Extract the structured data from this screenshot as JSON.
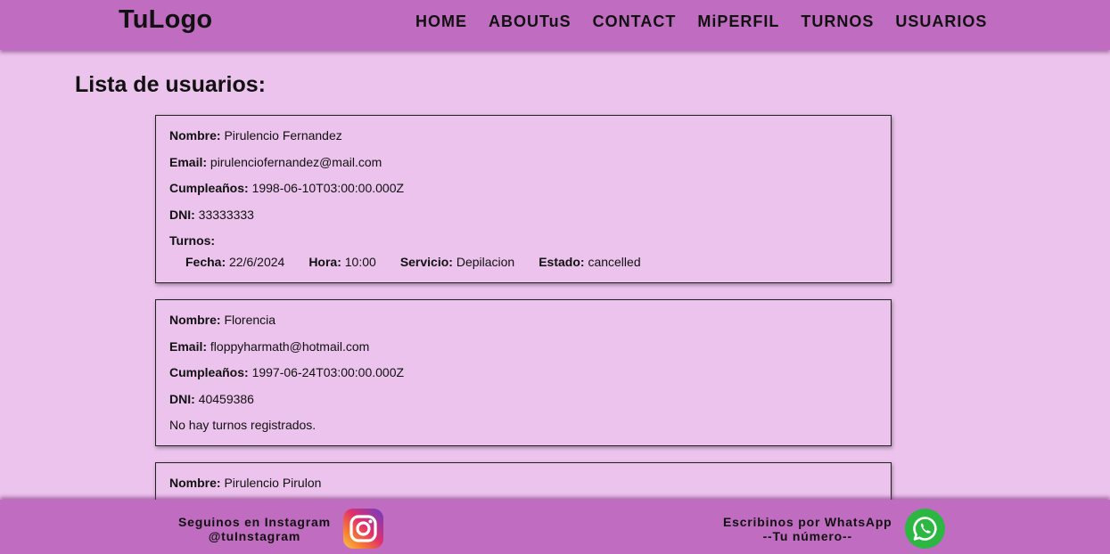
{
  "header": {
    "logo": "TuLogo",
    "nav": [
      "HOME",
      "ABOUTuS",
      "CONTACT",
      "MiPERFIL",
      "TURNOS",
      "USUARIOS"
    ]
  },
  "page_title": "Lista de usuarios:",
  "labels": {
    "nombre": "Nombre:",
    "email": "Email:",
    "cumple": "Cumpleaños:",
    "dni": "DNI:",
    "turnos": "Turnos:",
    "fecha": "Fecha:",
    "hora": "Hora:",
    "servicio": "Servicio:",
    "estado": "Estado:"
  },
  "users": [
    {
      "nombre": "Pirulencio Fernandez",
      "email": "pirulenciofernandez@mail.com",
      "cumple": "1998-06-10T03:00:00.000Z",
      "dni": "33333333",
      "turno": {
        "fecha": "22/6/2024",
        "hora": "10:00",
        "servicio": "Depilacion",
        "estado": "cancelled"
      }
    },
    {
      "nombre": "Florencia",
      "email": "floppyharmath@hotmail.com",
      "cumple": "1997-06-24T03:00:00.000Z",
      "dni": "40459386",
      "no_turnos": "No hay turnos registrados."
    },
    {
      "nombre": "Pirulencio Pirulon"
    }
  ],
  "footer": {
    "instagram_line1": "Seguinos en Instagram",
    "instagram_line2": "@tuInstagram",
    "whatsapp_line1": "Escribinos por WhatsApp",
    "whatsapp_line2": "--Tu número--"
  },
  "icons": {
    "instagram": "instagram-icon",
    "whatsapp": "whatsapp-icon"
  },
  "colors": {
    "header_bg": "#c06cc0",
    "page_bg": "#ebc3ec",
    "whatsapp_green": "#2bb741"
  }
}
